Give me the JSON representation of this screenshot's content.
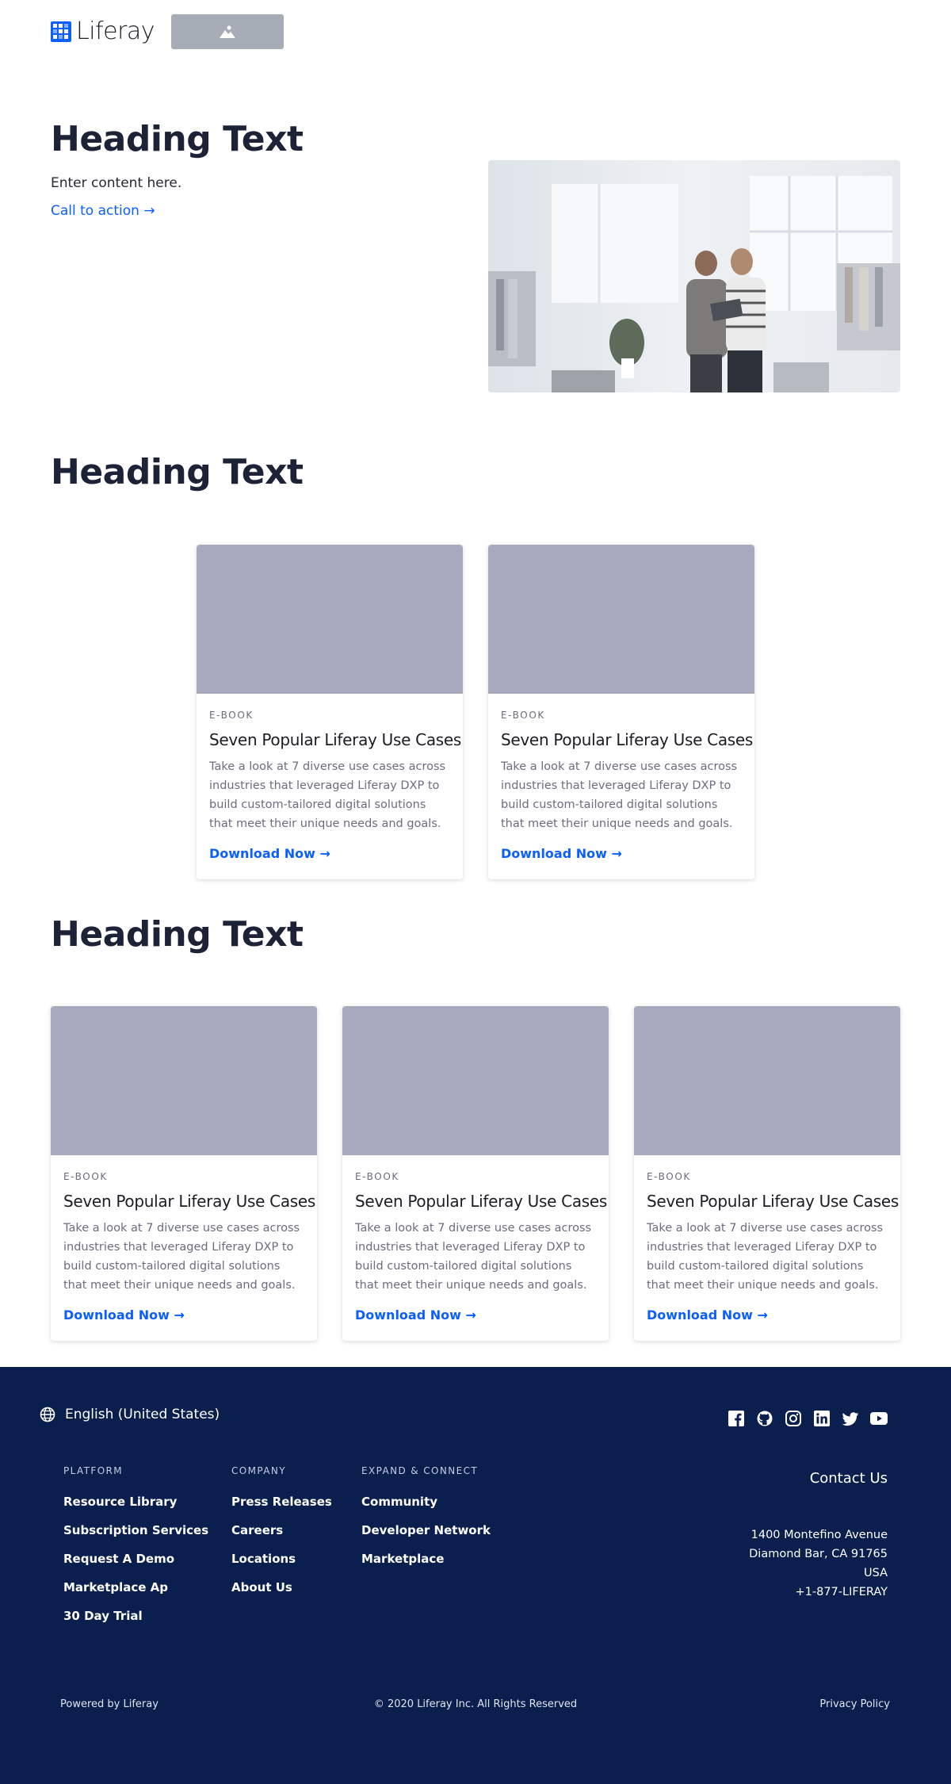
{
  "header": {
    "logo_text": "Liferay",
    "brand_color": "#0b5fff",
    "image_placeholder_icon": "image-icon"
  },
  "hero": {
    "heading": "Heading Text",
    "content": "Enter content here.",
    "cta": "Call to action →",
    "image_icon": "photo-two-people-shop"
  },
  "section2": {
    "heading": "Heading Text",
    "cards": [
      {
        "tag": "E-BOOK",
        "title": "Seven Popular Liferay Use Cases",
        "description": "Take a look at 7 diverse use cases across industries that leveraged Liferay DXP to build custom-tailored digital solutions that meet their unique needs and goals.",
        "link": "Download Now →"
      },
      {
        "tag": "E-BOOK",
        "title": "Seven Popular Liferay Use Cases",
        "description": "Take a look at 7 diverse use cases across industries that leveraged Liferay DXP to build custom-tailored digital solutions that meet their unique needs and goals.",
        "link": "Download Now →"
      }
    ]
  },
  "section3": {
    "heading": "Heading Text",
    "cards": [
      {
        "tag": "E-BOOK",
        "title": "Seven Popular Liferay Use Cases",
        "description": "Take a look at 7 diverse use cases across industries that leveraged Liferay DXP to build custom-tailored digital solutions that meet their unique needs and goals.",
        "link": "Download Now →"
      },
      {
        "tag": "E-BOOK",
        "title": "Seven Popular Liferay Use Cases",
        "description": "Take a look at 7 diverse use cases across industries that leveraged Liferay DXP to build custom-tailored digital solutions that meet their unique needs and goals.",
        "link": "Download Now →"
      },
      {
        "tag": "E-BOOK",
        "title": "Seven Popular Liferay Use Cases",
        "description": "Take a look at 7 diverse use cases across industries that leveraged Liferay DXP to build custom-tailored digital solutions that meet their unique needs and goals.",
        "link": "Download Now →"
      }
    ]
  },
  "footer": {
    "background": "#0b1f4f",
    "language": "English (United States)",
    "social_icons": [
      "facebook-icon",
      "github-icon",
      "instagram-icon",
      "linkedin-icon",
      "twitter-icon",
      "youtube-icon"
    ],
    "columns": [
      {
        "title": "PLATFORM",
        "links": [
          "Resource Library",
          "Subscription Services",
          "Request A Demo",
          "Marketplace Ap",
          "30 Day Trial"
        ]
      },
      {
        "title": "COMPANY",
        "links": [
          "Press Releases",
          "Careers",
          "Locations",
          "About Us"
        ]
      },
      {
        "title": "EXPAND & CONNECT",
        "links": [
          "Community",
          "Developer Network",
          "Marketplace"
        ]
      }
    ],
    "contact_title": "Contact Us",
    "address": [
      "1400 Montefino Avenue",
      "Diamond Bar, CA 91765",
      "USA",
      "+1-877-LIFERAY"
    ],
    "powered_by": "Powered by Liferay",
    "copyright": "© 2020 Liferay Inc. All Rights Reserved",
    "privacy": "Privacy Policy"
  }
}
